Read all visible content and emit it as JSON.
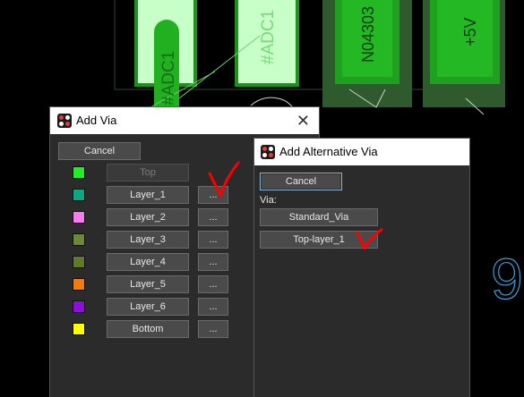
{
  "pcb": {
    "components": [
      "#ADC1",
      "#ADC1",
      "N04303",
      "+5V"
    ],
    "side_digit": "9"
  },
  "add_via": {
    "title": "Add Via",
    "close_glyph": "✕",
    "cancel_label": "Cancel",
    "more_label": "...",
    "layers": [
      {
        "name": "Top",
        "color": "#22ee22",
        "enabled": false
      },
      {
        "name": "Layer_1",
        "color": "#0fa684",
        "enabled": true
      },
      {
        "name": "Layer_2",
        "color": "#f47cf0",
        "enabled": true
      },
      {
        "name": "Layer_3",
        "color": "#6a8a3a",
        "enabled": true
      },
      {
        "name": "Layer_4",
        "color": "#5d7a2d",
        "enabled": true
      },
      {
        "name": "Layer_5",
        "color": "#f07c10",
        "enabled": true
      },
      {
        "name": "Layer_6",
        "color": "#8a10d6",
        "enabled": true
      },
      {
        "name": "Bottom",
        "color": "#ffff00",
        "enabled": true
      }
    ]
  },
  "alt_via": {
    "title": "Add Alternative Via",
    "cancel_label": "Cancel",
    "via_label": "Via:",
    "options": [
      "Standard_Via",
      "Top-layer_1"
    ]
  },
  "annotation_color": "#ff0000"
}
